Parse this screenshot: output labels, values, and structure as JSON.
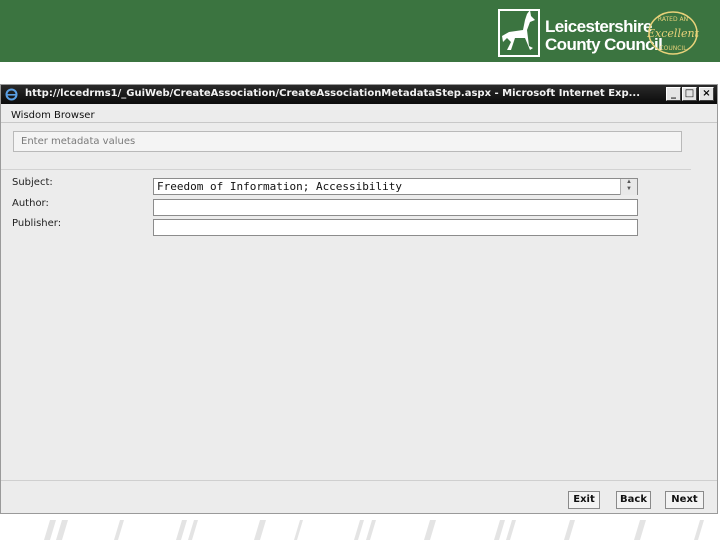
{
  "header": {
    "org_line1": "Leicestershire",
    "org_line2": "County Council",
    "seal_top": "RATED AN",
    "seal_middle": "Excellent",
    "seal_bottom": "COUNCIL",
    "banner_color": "#3b7440"
  },
  "window": {
    "title": "http://lccedrms1/_GuiWeb/CreateAssociation/CreateAssociationMetadataStep.aspx - Microsoft Internet Exp...",
    "minimize_label": "_",
    "maximize_label": "□",
    "close_label": "×",
    "browser_label": "Wisdom Browser"
  },
  "form": {
    "panel_header": "Enter metadata values",
    "subject_label": "Subject:",
    "subject_value": "Freedom of Information; Accessibility",
    "author_label": "Author:",
    "author_value": "",
    "publisher_label": "Publisher:",
    "publisher_value": ""
  },
  "footer": {
    "exit_label": "Exit",
    "back_label": "Back",
    "next_label": "Next"
  },
  "icons": {
    "logo": "fox-icon",
    "browser": "internet-explorer-icon",
    "spinner_up": "spinner-up-icon",
    "spinner_down": "spinner-down-icon"
  }
}
